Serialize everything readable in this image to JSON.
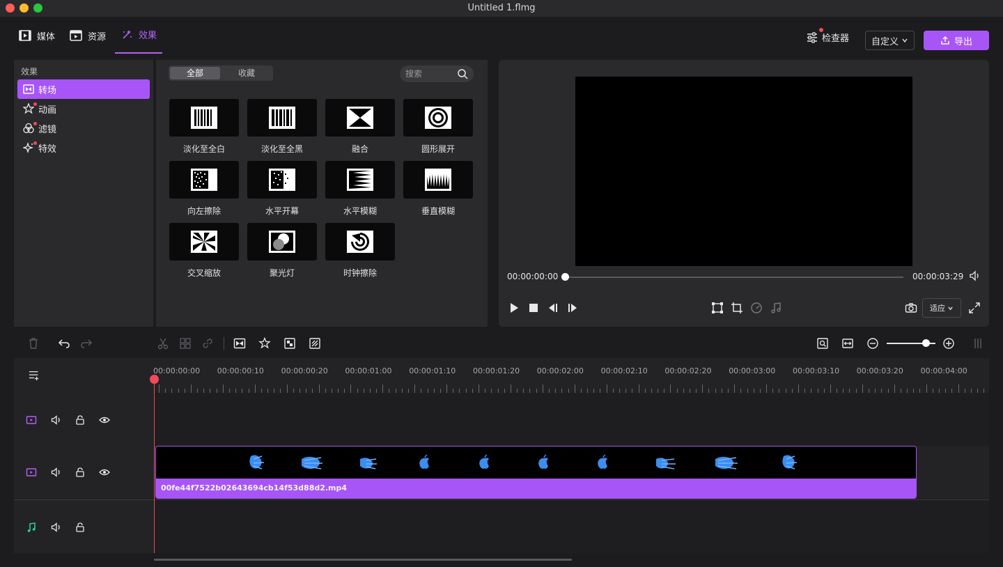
{
  "window": {
    "title": "Untitled 1.flmg"
  },
  "top_tabs": [
    {
      "label": "媒体",
      "icon": "media-icon"
    },
    {
      "label": "资源",
      "icon": "resource-icon"
    },
    {
      "label": "效果",
      "icon": "effects-sparkle-icon"
    }
  ],
  "header": {
    "inspector_label": "检查器",
    "preset_value": "自定义",
    "export_label": "导出"
  },
  "sidebar": {
    "title": "效果",
    "items": [
      {
        "label": "转场",
        "icon": "transition-icon"
      },
      {
        "label": "动画",
        "icon": "animation-icon"
      },
      {
        "label": "滤镜",
        "icon": "filter-icon"
      },
      {
        "label": "特效",
        "icon": "special-effect-icon"
      }
    ]
  },
  "effects_panel": {
    "segments": {
      "all": "全部",
      "favorites": "收藏"
    },
    "search_placeholder": "搜索",
    "items": [
      {
        "label": "淡化至全白"
      },
      {
        "label": "淡化至全黑"
      },
      {
        "label": "融合"
      },
      {
        "label": "圆形展开"
      },
      {
        "label": "向左擦除"
      },
      {
        "label": "水平开幕"
      },
      {
        "label": "水平模糊"
      },
      {
        "label": "垂直模糊"
      },
      {
        "label": "交叉缩放"
      },
      {
        "label": "聚光灯"
      },
      {
        "label": "时钟擦除"
      }
    ]
  },
  "preview": {
    "current_time": "00:00:00:00",
    "duration": "00:00:03:29",
    "playback_progress": 0,
    "fit_label": "适应"
  },
  "timeline": {
    "ruler_labels": [
      "00:00:00:00",
      "00:00:00:10",
      "00:00:00:20",
      "00:00:01:00",
      "00:00:01:10",
      "00:00:01:20",
      "00:00:02:00",
      "00:00:02:10",
      "00:00:02:20",
      "00:00:03:00",
      "00:00:03:10",
      "00:00:03:20",
      "00:00:04:00"
    ],
    "clip_name": "00fe44f7522b02643694cb14f53d88d2.mp4",
    "zoom_level": 0.8
  },
  "colors": {
    "accent": "#a855f7",
    "playhead": "#f24a5a",
    "panel": "#2a2a2c",
    "background": "#1c1c1e",
    "audio_icon": "#2ed197"
  }
}
